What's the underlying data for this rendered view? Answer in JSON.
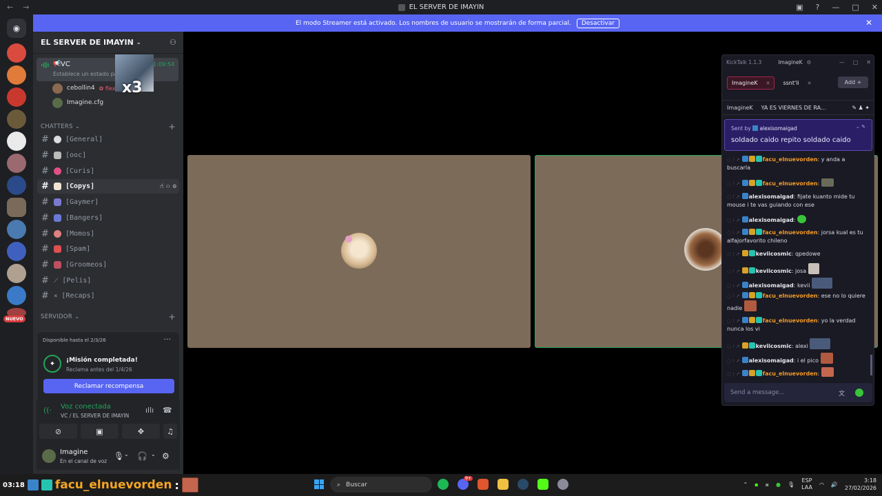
{
  "window": {
    "title": "EL SERVER DE IMAYIN"
  },
  "banner": {
    "text": "El modo Streamer está activado. Los nombres de usuario se mostrarán de forma parcial.",
    "button": "Desactivar"
  },
  "sidebar": {
    "server_name": "EL SERVER DE IMAYIN",
    "voice_channel": {
      "name": "VC",
      "status": "Establece un estado para el",
      "timer": "1:09:54",
      "stream_badge": "x3"
    },
    "members": [
      "cebollin4",
      "Imagine.cfg"
    ],
    "member_tag": "flex",
    "category_chatters": "CHATTERS",
    "channels": [
      "[General]",
      "[ooc]",
      "[Curis]",
      "[Copys]",
      "[Gaymer]",
      "[Bangers]",
      "[Momos]",
      "[Spam]",
      "[Groomeos]",
      "[Pelis]",
      "[Recaps]"
    ],
    "category_servidor": "SERVIDOR",
    "nuevo_badge": "NUEVO"
  },
  "quest": {
    "available": "Disponible hasta el 2/3/26",
    "title": "¡Misión completada!",
    "subtitle": "Reclama antes del 1/4/26",
    "button": "Reclamar recompensa"
  },
  "voice": {
    "title": "Voz conectada",
    "subtitle": "VC / EL SERVER DE IMAYIN"
  },
  "user": {
    "name": "Imagine",
    "status": "En el canal de voz"
  },
  "kicktalk": {
    "version": "KickTalk 1.1.3",
    "account": "ImagineK",
    "tabs": [
      "ImagineK",
      "ssnt'li"
    ],
    "add_button": "Add",
    "pinned": {
      "user": "ImagineK",
      "text": "YA ES VIERNES DE RA..."
    },
    "sent_by_label": "Sent by",
    "sent_by_user": "alexisomaigad",
    "sent_message": "soldado caido repito soldado caido",
    "messages": [
      {
        "user": "facu_elnuevorden",
        "text": "y anda a buscarla"
      },
      {
        "user": "facu_elnuevorden",
        "text": ""
      },
      {
        "user": "alexisomaigad",
        "text": "fijate kuanto mide tu mouse i te vas guiando con ese"
      },
      {
        "user": "alexisomaigad",
        "text": ""
      },
      {
        "user": "facu_elnuevorden",
        "text": "jorsa kual es tu alfajorfavorito chileno"
      },
      {
        "user": "keviicosmic",
        "text": "qpedowe"
      },
      {
        "user": "keviicosmic",
        "text": "josa"
      },
      {
        "user": "alexisomaigad",
        "text": "kevii"
      },
      {
        "user": "facu_elnuevorden",
        "text": "ese no lo quiere nadie"
      },
      {
        "user": "facu_elnuevorden",
        "text": "yo la verdad nunca los vi"
      },
      {
        "user": "keviicosmic",
        "text": "alexi"
      },
      {
        "user": "alexisomaigad",
        "text": "i el pico"
      },
      {
        "user": "facu_elnuevorden",
        "text": ""
      }
    ],
    "input_placeholder": "Send a message..."
  },
  "taskbar": {
    "overlay_time": "03:18",
    "overlay_name": "facu_elnuevorden",
    "overlay_colon": ":",
    "search": "Buscar",
    "lang1": "ESP",
    "lang2": "LAA",
    "time": "3:18",
    "date": "27/02/2026",
    "discord_badge": "9+"
  }
}
